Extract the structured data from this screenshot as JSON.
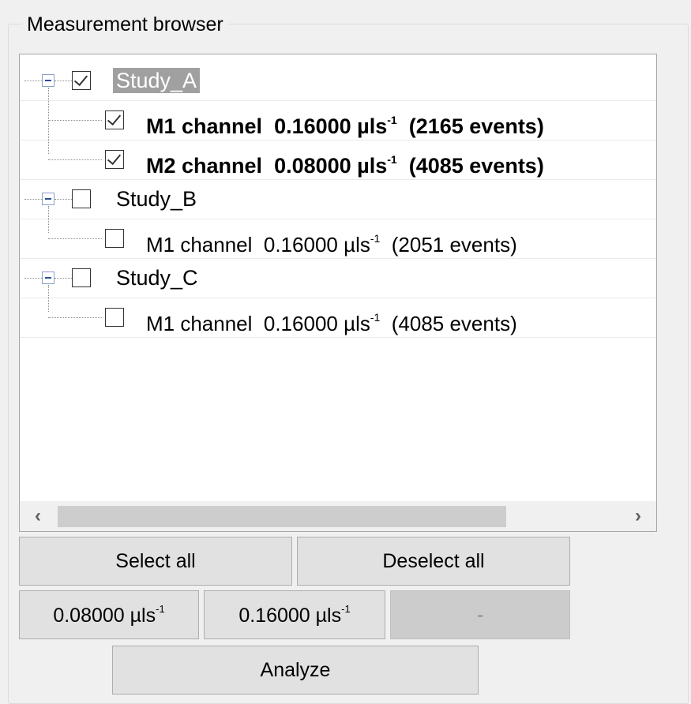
{
  "panel": {
    "title": "Measurement browser"
  },
  "tree": {
    "studies": [
      {
        "name": "Study_A",
        "checked": true,
        "selected": true,
        "channels": [
          {
            "name": "M1 channel",
            "rate": "0.16000 µls",
            "exp": "-1",
            "events": "(2165 events)",
            "checked": true
          },
          {
            "name": "M2 channel",
            "rate": "0.08000 µls",
            "exp": "-1",
            "events": "(4085 events)",
            "checked": true
          }
        ]
      },
      {
        "name": "Study_B",
        "checked": false,
        "selected": false,
        "channels": [
          {
            "name": "M1 channel",
            "rate": "0.16000 µls",
            "exp": "-1",
            "events": "(2051 events)",
            "checked": false
          }
        ]
      },
      {
        "name": "Study_C",
        "checked": false,
        "selected": false,
        "channels": [
          {
            "name": "M1 channel",
            "rate": "0.16000 µls",
            "exp": "-1",
            "events": "(4085 events)",
            "checked": false
          }
        ]
      }
    ],
    "scroll_left_icon": "chevron-left-icon",
    "scroll_right_icon": "chevron-right-icon"
  },
  "buttons": {
    "select_all": "Select all",
    "deselect_all": "Deselect all",
    "rate_1": "0.08000 µls",
    "rate_2": "0.16000 µls",
    "rate_exp": "-1",
    "rate_3": "-",
    "analyze": "Analyze"
  }
}
